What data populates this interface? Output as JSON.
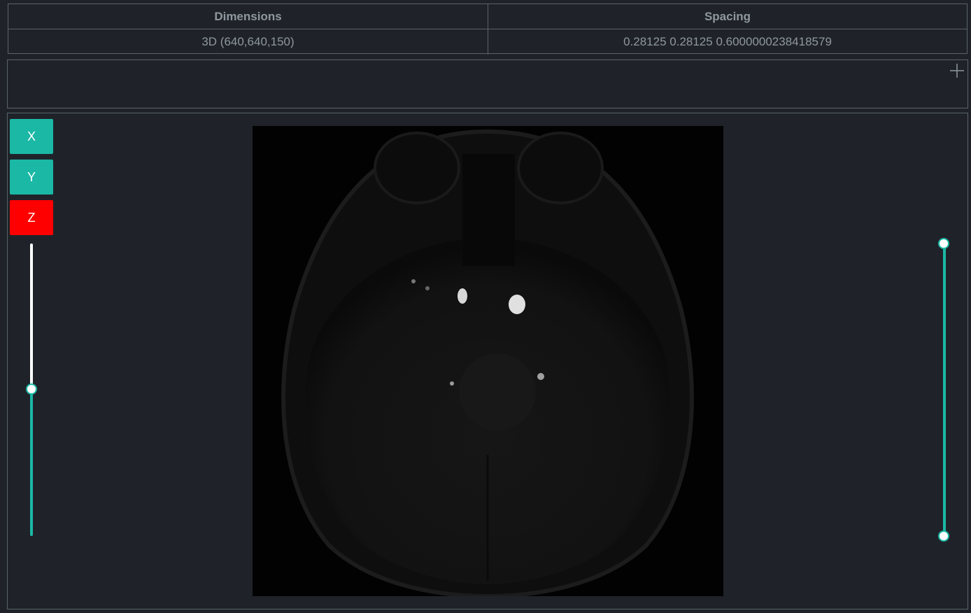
{
  "info_table": {
    "headers": [
      "Dimensions",
      "Spacing"
    ],
    "values": [
      "3D (640,640,150)",
      "0.28125 0.28125 0.6000000238418579"
    ]
  },
  "toolbar": {
    "add_icon": "plus-icon"
  },
  "axis_buttons": [
    {
      "label": "X",
      "color": "#1bb8a6"
    },
    {
      "label": "Y",
      "color": "#1bb8a6"
    },
    {
      "label": "Z",
      "color": "#ff0000"
    }
  ],
  "slice_slider": {
    "value_fraction": 0.5
  },
  "window_slider": {
    "upper_fraction": 1.0,
    "lower_fraction": 0.0
  },
  "image": {
    "description_icon": "mri-axial-slice"
  },
  "colors": {
    "accent": "#1bb8a6",
    "active": "#ff0000",
    "background": "#1f2329",
    "border": "#5a626c"
  }
}
